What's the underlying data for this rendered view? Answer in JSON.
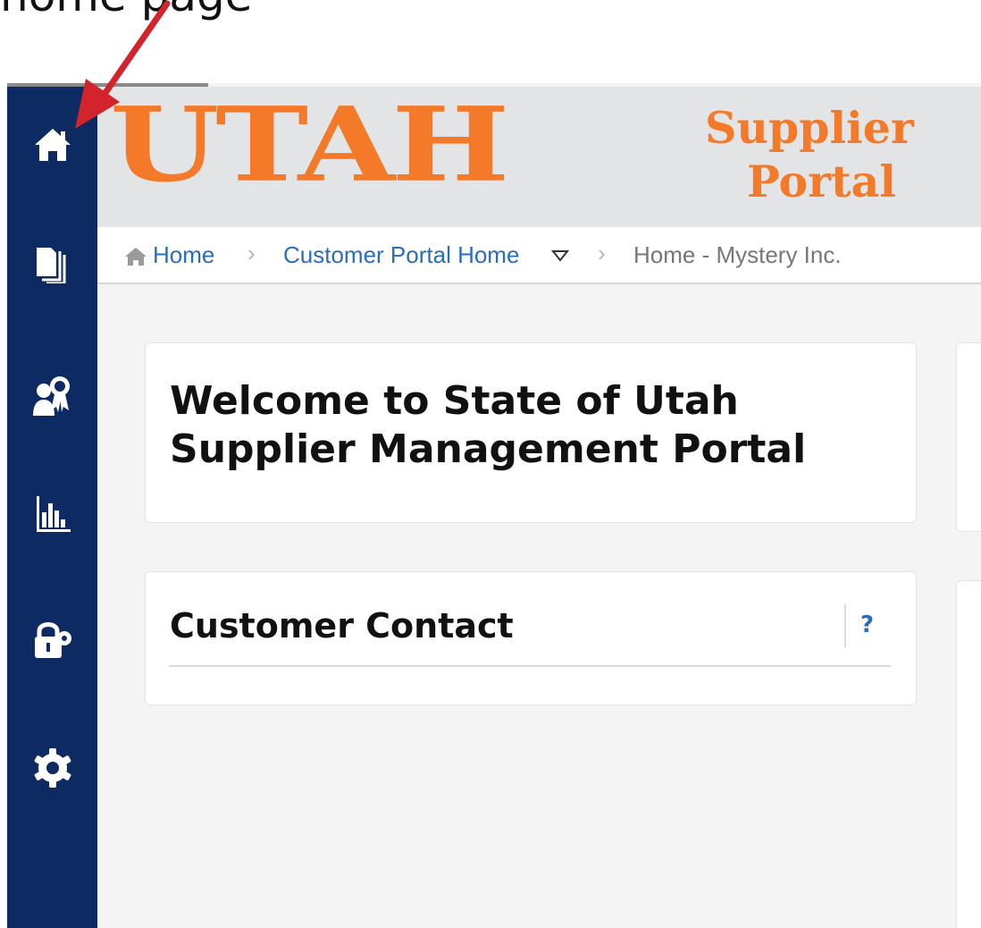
{
  "annotation": {
    "caption": "home page",
    "arrow_color": "#d3232b"
  },
  "header": {
    "logo_main": "UTAH",
    "logo_line1": "Supplier",
    "logo_line2": "Portal",
    "logo_color": "#f47a2a"
  },
  "sidebar": {
    "background": "#0d2a62",
    "items": [
      {
        "icon": "home-icon"
      },
      {
        "icon": "documents-icon"
      },
      {
        "icon": "certified-user-icon"
      },
      {
        "icon": "bar-chart-icon"
      },
      {
        "icon": "lock-gear-icon"
      },
      {
        "icon": "settings-gear-icon"
      }
    ]
  },
  "breadcrumb": {
    "home": "Home",
    "customer_portal": "Customer Portal Home",
    "current": "Home - Mystery Inc."
  },
  "welcome": {
    "title": "Welcome to State of Utah Supplier Management Portal"
  },
  "customer_contact": {
    "title": "Customer Contact",
    "help": "?"
  }
}
